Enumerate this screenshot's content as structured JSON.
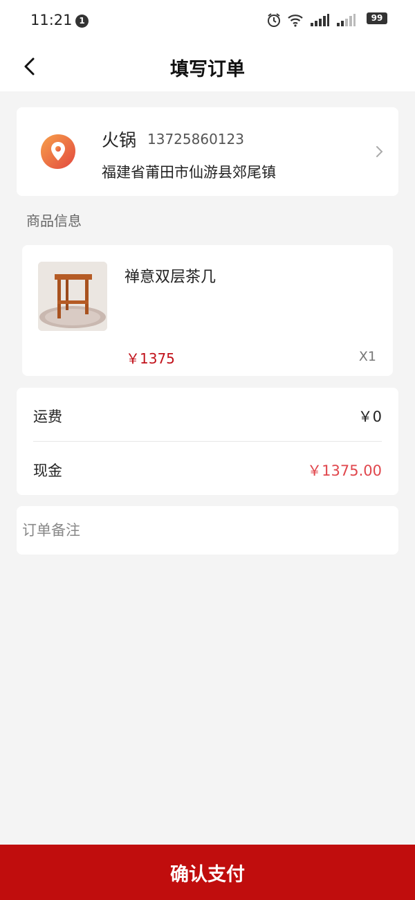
{
  "status_bar": {
    "time": "11:21",
    "notification_count": "1",
    "battery": "99",
    "icons": [
      "alarm-icon",
      "wifi-icon",
      "signal-icon",
      "signal-icon"
    ]
  },
  "header": {
    "title": "填写订单",
    "back_icon": "chevron-left-icon"
  },
  "address": {
    "name": "火锅",
    "phone": "13725860123",
    "detail": "福建省莆田市仙游县郊尾镇",
    "icon": "location-pin-icon",
    "accent_color": "#f08a3c"
  },
  "product_section": {
    "label": "商品信息",
    "product": {
      "name": "禅意双层茶几",
      "price": "￥1375",
      "quantity": "X1"
    }
  },
  "fees": {
    "shipping": {
      "label": "运费",
      "value": "￥0"
    },
    "cash": {
      "label": "现金",
      "value": "￥1375.00"
    }
  },
  "note": {
    "placeholder": "订单备注",
    "value": ""
  },
  "footer": {
    "pay_label": "确认支付"
  },
  "colors": {
    "brand_red": "#c00d0d",
    "price_red": "#c1111a",
    "cash_red": "#e0464c"
  }
}
